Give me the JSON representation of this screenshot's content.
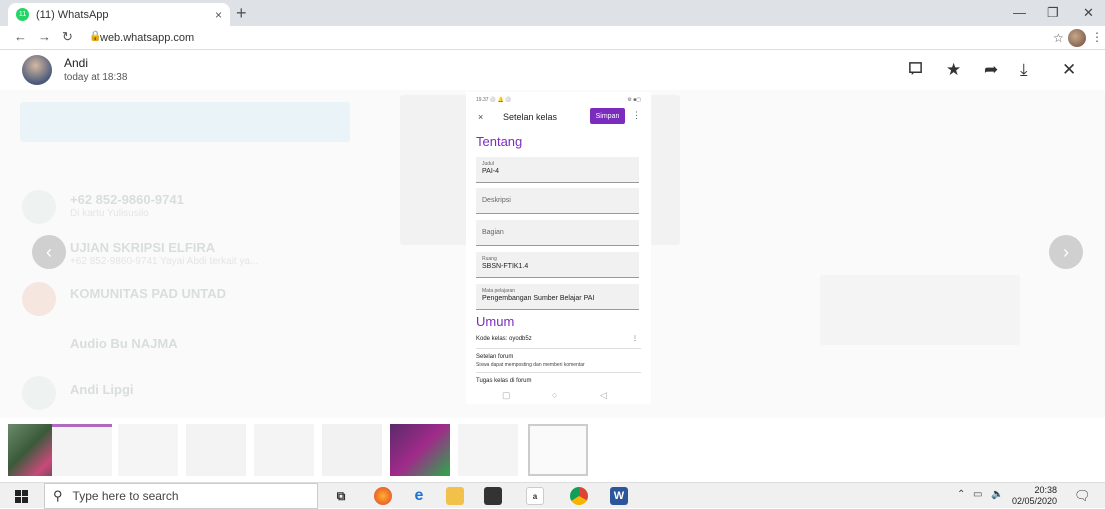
{
  "browser": {
    "tab_title": "(11) WhatsApp",
    "tab_badge": "11",
    "tab_close": "×",
    "new_tab": "+",
    "url": "web.whatsapp.com",
    "win_min": "—",
    "win_restore": "❐",
    "win_close": "✕"
  },
  "viewer": {
    "sender": "Andi",
    "timestamp": "today at 18:38",
    "icons": [
      "message-icon",
      "star-icon",
      "forward-icon",
      "download-icon",
      "close-icon"
    ]
  },
  "background_chat": {
    "items": [
      {
        "title": "+62 852-9860-9741",
        "sub": "Di kartu Yulisusilo"
      },
      {
        "title": "UJIAN SKRIPSI ELFIRA",
        "sub": "+62 852-9860-9741 Yayai Abdi terkait ya..."
      },
      {
        "title": "KOMUNITAS PAD UNTAD",
        "sub": ""
      },
      {
        "title": "Audio Bu NAJMA",
        "sub": ""
      },
      {
        "title": "Andi Lipgi",
        "sub": ""
      }
    ]
  },
  "phone": {
    "status_time": "19.37 ⚪ 🔔 ⚪",
    "status_right": "⚙ ■▢",
    "close": "×",
    "title": "Setelan kelas",
    "save_label": "Simpan",
    "menu": "⋮",
    "section_about": "Tentang",
    "fields": {
      "judul_label": "Judul",
      "judul_value": "PAI-4",
      "deskripsi_placeholder": "Deskripsi",
      "bagian_placeholder": "Bagian",
      "ruang_label": "Ruang",
      "ruang_value": "SBSN-FTIK1.4",
      "mapel_label": "Mata pelajaran",
      "mapel_value": "Pengembangan Sumber Belajar PAI"
    },
    "section_general": "Umum",
    "class_code": "Kode kelas: oyodb5z",
    "forum_title": "Setelan forum",
    "forum_sub": "Siswa dapat memposting dan memberi komentar",
    "class_tasks": "Tugas kelas di forum",
    "nav": [
      "▢",
      "○",
      "◁"
    ]
  },
  "taskbar": {
    "search_placeholder": "Type here to search",
    "time": "20:38",
    "date": "02/05/2020"
  },
  "colors": {
    "accent": "#7b2cbf",
    "whatsapp": "#25d366"
  }
}
